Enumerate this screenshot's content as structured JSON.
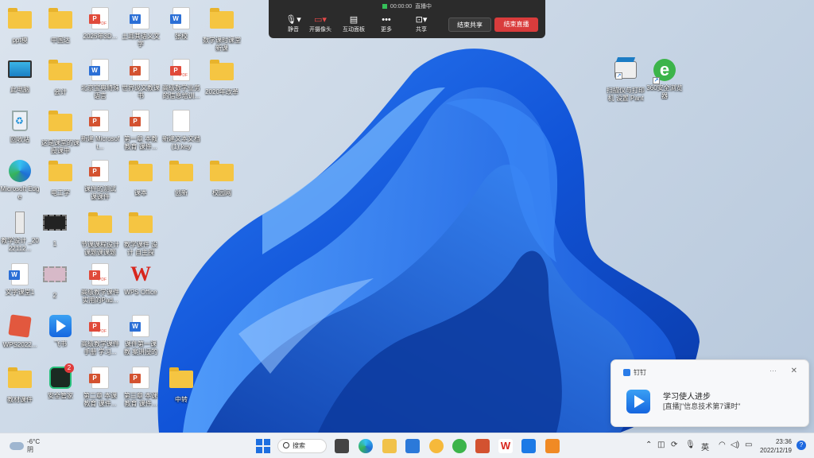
{
  "desktop": {
    "icons": [
      {
        "label": "ppt模",
        "kind": "folder"
      },
      {
        "label": "Microsoft Edge",
        "kind": "edge"
      },
      {
        "label": "中国达",
        "kind": "folder"
      },
      {
        "label": "2025年3D...",
        "kind": "pdf"
      },
      {
        "label": "土耳其语义文字",
        "kind": "word"
      },
      {
        "label": "张校",
        "kind": "word"
      },
      {
        "label": "数学课时课堂 新课",
        "kind": "folder"
      },
      {
        "label": "此电脑",
        "kind": "pc"
      },
      {
        "label": "会计",
        "kind": "folder"
      },
      {
        "label": "北京宝典特殊 语言",
        "kind": "word"
      },
      {
        "label": "世界说文教课 书",
        "kind": "ppt"
      },
      {
        "label": "高级数学业务 的信息培训...",
        "kind": "pdf"
      },
      {
        "label": "2020年改革",
        "kind": "folder"
      },
      {
        "label": "回收站",
        "kind": "bin"
      },
      {
        "label": "这是课堂的课 授课中",
        "kind": "folder"
      },
      {
        "label": "新建 Microsoft...",
        "kind": "ppt"
      },
      {
        "label": "第一章 本教 教育 课件...",
        "kind": "ppt"
      },
      {
        "label": "新建文本文档 (1).key",
        "kind": "doc"
      },
      {
        "label": "Microsoft Edge",
        "kind": "edge"
      },
      {
        "label": "电工学",
        "kind": "folder"
      },
      {
        "label": "课件的测试 课课件",
        "kind": "ppt"
      },
      {
        "label": "课本",
        "kind": "folder"
      },
      {
        "label": "创新",
        "kind": "folder"
      },
      {
        "label": "校园网",
        "kind": "folder"
      },
      {
        "label": "教学设计 _2022112...",
        "kind": "server"
      },
      {
        "label": "1",
        "kind": "film"
      },
      {
        "label": "节课课程设计 课题课课题",
        "kind": "folder"
      },
      {
        "label": "教学课件 设计 自主探",
        "kind": "folder"
      },
      {
        "label": "文字课堂1",
        "kind": "word"
      },
      {
        "label": "2",
        "kind": "film2"
      },
      {
        "label": "高级教学课件 实用的Pad...",
        "kind": "pdf"
      },
      {
        "label": "WPS Office",
        "kind": "wps"
      },
      {
        "label": "WPS2022...",
        "kind": "wpsbox"
      },
      {
        "label": "飞书",
        "kind": "feishu"
      },
      {
        "label": "高级教学课件 手册 学习...",
        "kind": "pdf"
      },
      {
        "label": "课件第一课 教 案讲授的学习",
        "kind": "word"
      },
      {
        "label": "教材课件",
        "kind": "folder"
      },
      {
        "label": "安全管家",
        "kind": "defender",
        "badge": "2"
      },
      {
        "label": "第二章 本课 教育 课件...",
        "kind": "ppt"
      },
      {
        "label": "第三章 本课 教育 课件...",
        "kind": "ppt"
      },
      {
        "label": "中转",
        "kind": "folder"
      },
      {
        "label": "扫描仪与打印机 设置 Panta...",
        "kind": "scanner"
      },
      {
        "label": "360安全浏览器",
        "kind": "ie"
      }
    ]
  },
  "meeting_bar": {
    "timer": "00:00:00",
    "status": "直播中",
    "tools": [
      {
        "label": "静音",
        "icon": "mic-icon"
      },
      {
        "label": "开摄像头",
        "icon": "camera-icon"
      },
      {
        "label": "互动面板",
        "icon": "panel-icon"
      },
      {
        "label": "更多",
        "icon": "more-icon"
      },
      {
        "label": "共享",
        "icon": "share-icon"
      }
    ],
    "end_share_label": "结束共享",
    "end_live_label": "结束直播"
  },
  "notification": {
    "app_name": "钉钉",
    "title": "学习使人进步",
    "body": "[直播]\"信息技术第7课时\""
  },
  "taskbar": {
    "weather_temp": "-6°C",
    "weather_desc": "阴",
    "search_label": "搜索",
    "lang": "英",
    "time": "23:36",
    "date": "2022/12/19"
  }
}
